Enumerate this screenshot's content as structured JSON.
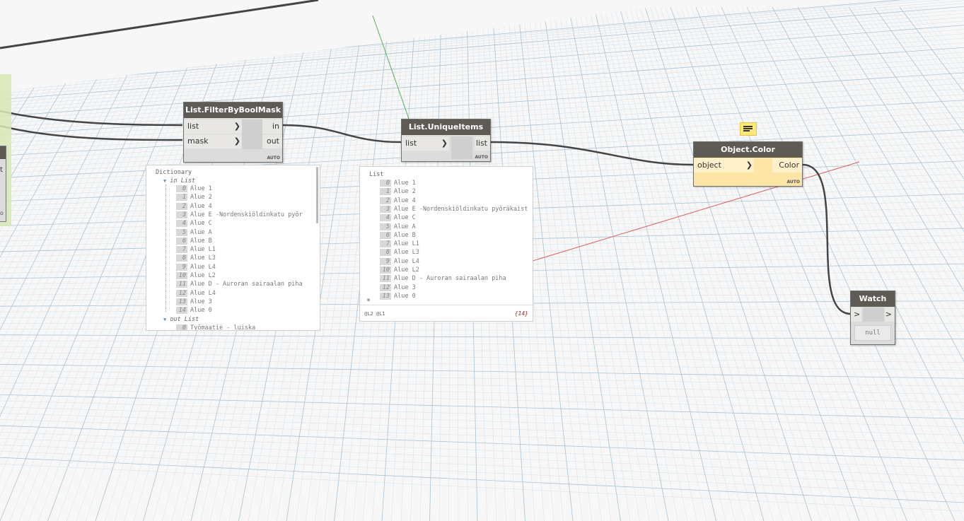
{
  "nodes": {
    "filter": {
      "title": "List.FilterByBoolMask",
      "in1": "list",
      "in2": "mask",
      "out1": "in",
      "out2": "out",
      "auto": "AUTO"
    },
    "unique": {
      "title": "List.UniqueItems",
      "in1": "list",
      "out1": "list",
      "auto": "AUTO"
    },
    "color": {
      "title": "Object.Color",
      "in1": "object",
      "out1": "Color",
      "auto": "AUTO"
    },
    "watch": {
      "title": "Watch",
      "in_marker": ">",
      "out_marker": ">",
      "value": "null"
    },
    "left_partial": {
      "label_t": "t",
      "label_o": "o"
    }
  },
  "preview1": {
    "header": "Dictionary",
    "in_label": "in List",
    "out_label": "out List",
    "items": [
      {
        "i": "0",
        "t": "Alue 1"
      },
      {
        "i": "1",
        "t": "Alue 2"
      },
      {
        "i": "2",
        "t": "Alue 4"
      },
      {
        "i": "3",
        "t": "Alue E -Nordenskiöldinkatu pyör"
      },
      {
        "i": "4",
        "t": "Alue C"
      },
      {
        "i": "5",
        "t": "Alue A"
      },
      {
        "i": "6",
        "t": "Alue B"
      },
      {
        "i": "7",
        "t": "Alue L1"
      },
      {
        "i": "8",
        "t": "Alue L3"
      },
      {
        "i": "9",
        "t": "Alue L4"
      },
      {
        "i": "10",
        "t": "Alue L2"
      },
      {
        "i": "11",
        "t": "Alue D - Auroran sairaalan piha"
      },
      {
        "i": "12",
        "t": "Alue L4"
      },
      {
        "i": "13",
        "t": "Alue 3"
      },
      {
        "i": "14",
        "t": "Alue 0"
      }
    ],
    "out_first": {
      "i": "0",
      "t": "Työmaatie - luiska"
    }
  },
  "preview2": {
    "header": "List",
    "items": [
      {
        "i": "0",
        "t": "Alue 1"
      },
      {
        "i": "1",
        "t": "Alue 2"
      },
      {
        "i": "2",
        "t": "Alue 4"
      },
      {
        "i": "3",
        "t": "Alue E -Nordenskiöldinkatu pyöräkaist"
      },
      {
        "i": "4",
        "t": "Alue C"
      },
      {
        "i": "5",
        "t": "Alue A"
      },
      {
        "i": "6",
        "t": "Alue B"
      },
      {
        "i": "7",
        "t": "Alue L1"
      },
      {
        "i": "8",
        "t": "Alue L3"
      },
      {
        "i": "9",
        "t": "Alue L4"
      },
      {
        "i": "10",
        "t": "Alue L2"
      },
      {
        "i": "11",
        "t": "Alue D - Auroran sairaalan piha"
      },
      {
        "i": "12",
        "t": "Alue 3"
      },
      {
        "i": "13",
        "t": "Alue 0"
      }
    ],
    "levels": "@L2 @L1",
    "count": "{14}"
  },
  "colors": {
    "title_bar": "#5e5a54",
    "node_body": "#dcdcdc",
    "color_node_body": "#fde5a6",
    "grid": "#c8dbe6",
    "wire": "#444444",
    "x_axis": "#e06060",
    "y_axis": "#60b060"
  }
}
